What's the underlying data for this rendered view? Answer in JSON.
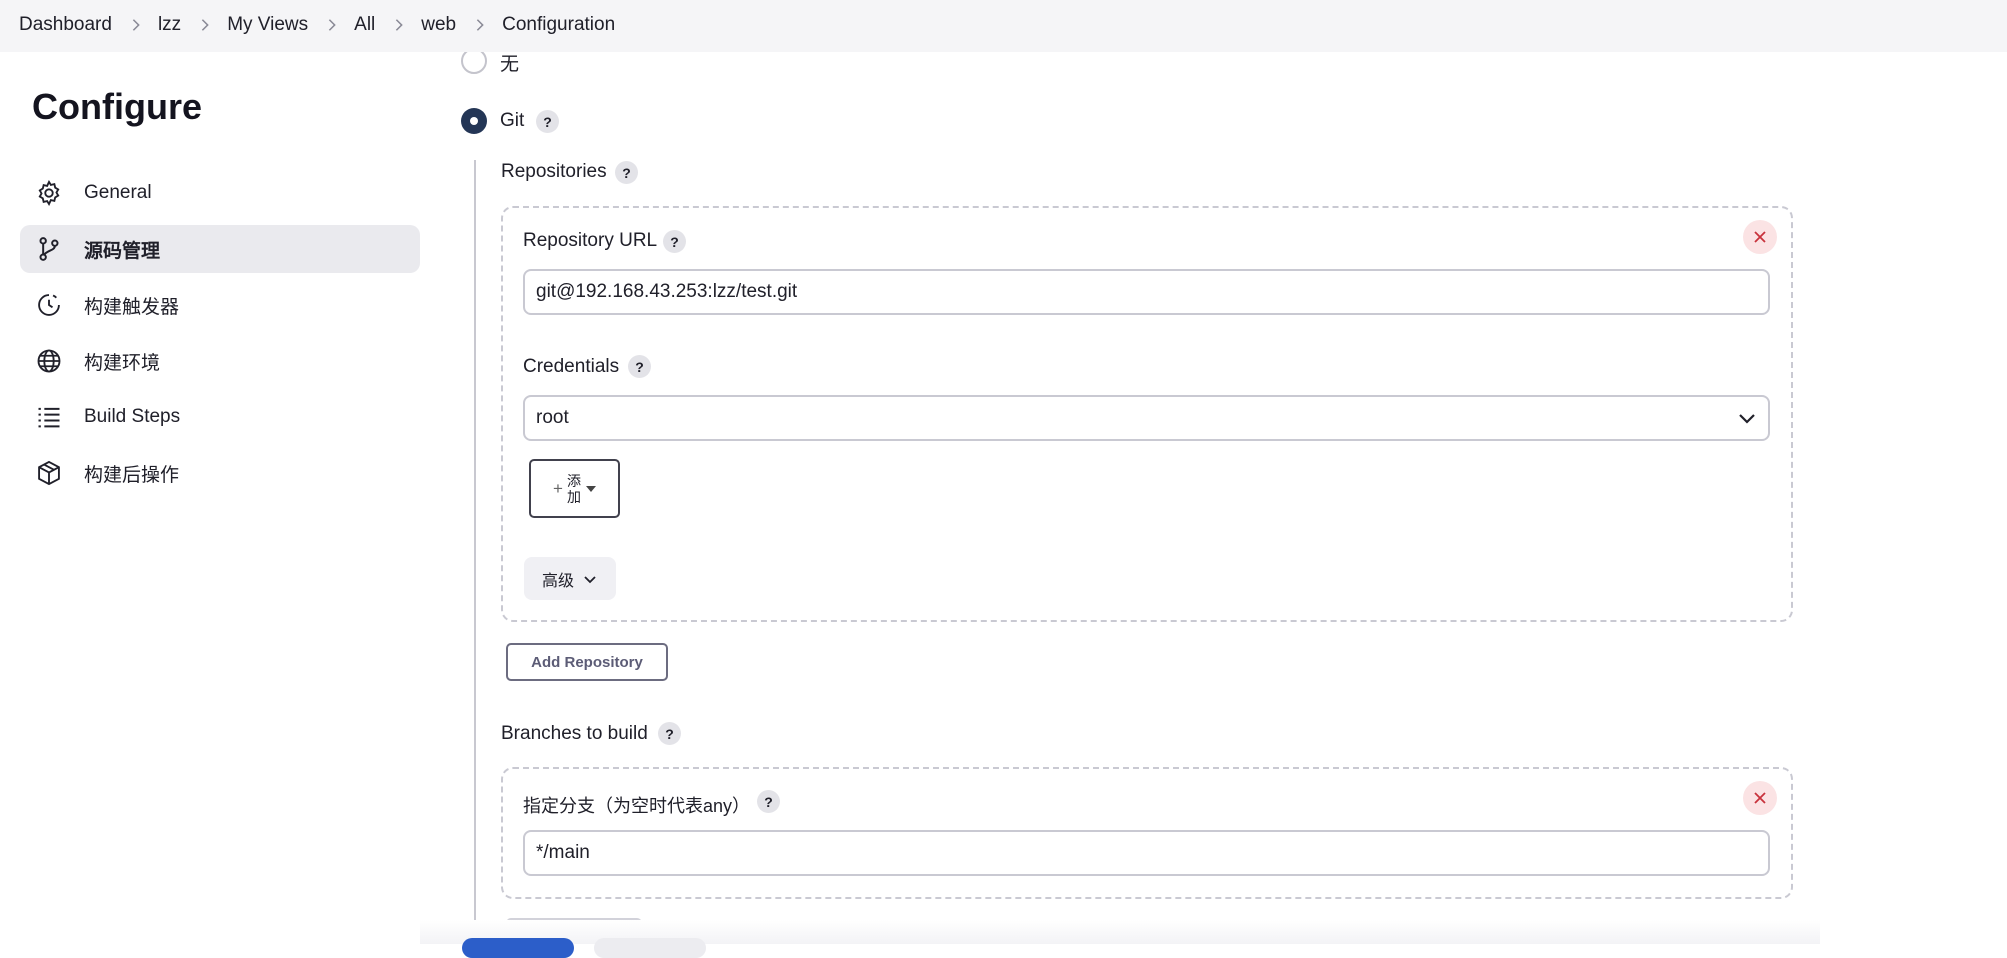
{
  "breadcrumb": [
    "Dashboard",
    "lzz",
    "My Views",
    "All",
    "web",
    "Configuration"
  ],
  "page_title": "Configure",
  "sidebar": {
    "items": [
      {
        "label": "General",
        "icon": "gear-icon",
        "active": false
      },
      {
        "label": "源码管理",
        "icon": "git-branch-icon",
        "active": true
      },
      {
        "label": "构建触发器",
        "icon": "clock-icon",
        "active": false
      },
      {
        "label": "构建环境",
        "icon": "globe-icon",
        "active": false
      },
      {
        "label": "Build Steps",
        "icon": "list-icon",
        "active": false
      },
      {
        "label": "构建后操作",
        "icon": "package-icon",
        "active": false
      }
    ]
  },
  "scm": {
    "option_none": "无",
    "option_git": "Git",
    "selected": "Git",
    "help": "?",
    "repositories_label": "Repositories",
    "repository_url_label": "Repository URL",
    "repository_url_value": "git@192.168.43.253:lzz/test.git",
    "credentials_label": "Credentials",
    "credentials_value": "root",
    "add_label": "添加",
    "advanced_label": "高级",
    "add_repository_label": "Add Repository",
    "branches_label": "Branches to build",
    "branch_spec_label": "指定分支（为空时代表any）",
    "branch_spec_value": "*/main"
  },
  "colors": {
    "accent": "#243656",
    "primary_button": "#2c5ec9",
    "delete": "#c8323c",
    "sidebar_active": "#eaeaee"
  }
}
